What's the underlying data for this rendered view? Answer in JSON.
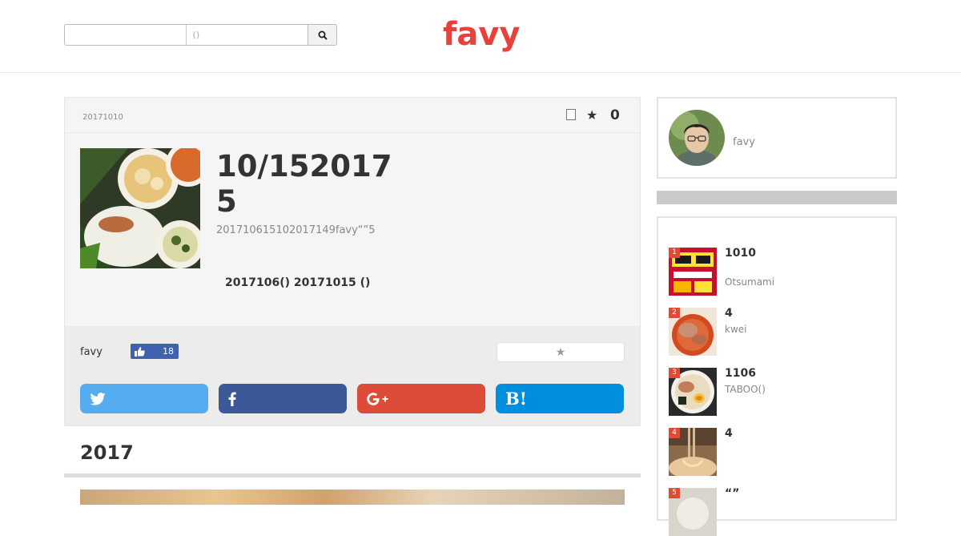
{
  "header": {
    "search_placeholder": "()",
    "logo_text": "favy",
    "logo_color": "#e8413a"
  },
  "article": {
    "date": "20171010",
    "favorite_count": "0",
    "title": "10/152017 5",
    "summary": "201710615102017149favy“”5",
    "event": "2017106()  20171015 ()",
    "author": "favy",
    "like_count": "18",
    "section_heading": "2017"
  },
  "share_colors": {
    "twitter": "#55acee",
    "facebook": "#3b5998",
    "google_plus": "#dd4b39",
    "hatena": "#008fde"
  },
  "share": {
    "hatena_label": "B!"
  },
  "sidebar": {
    "profile_name": "favy",
    "ranking": [
      {
        "rank": "1",
        "title": "1010",
        "author": "Otsumami"
      },
      {
        "rank": "2",
        "title": "4",
        "author": "kwei"
      },
      {
        "rank": "3",
        "title": "1106",
        "author": "TABOO()"
      },
      {
        "rank": "4",
        "title": "4",
        "author": ""
      },
      {
        "rank": "5",
        "title": "“”",
        "author": ""
      }
    ]
  }
}
